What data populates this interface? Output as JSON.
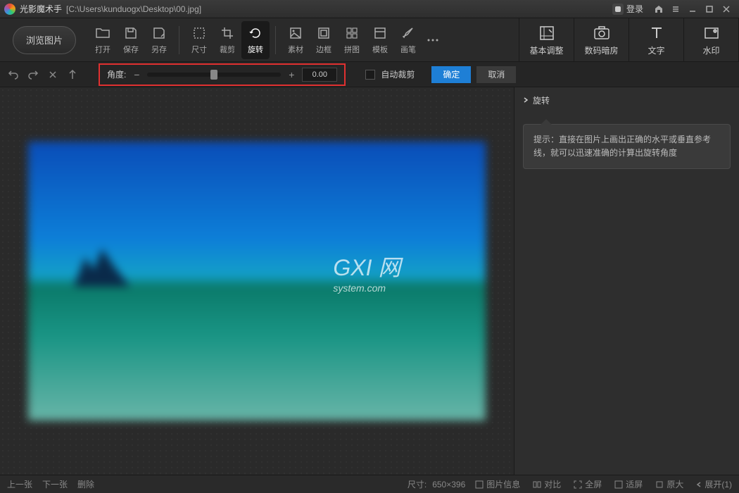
{
  "titlebar": {
    "app_name": "光影魔术手",
    "file_path": "[C:\\Users\\kunduogx\\Desktop\\00.jpg]",
    "login_label": "登录"
  },
  "toolbar": {
    "browse_label": "浏览图片",
    "items": [
      "打开",
      "保存",
      "另存",
      "尺寸",
      "裁剪",
      "旋转",
      "素材",
      "边框",
      "拼图",
      "模板",
      "画笔"
    ],
    "active_index": 5
  },
  "right_tools": [
    "基本调整",
    "数码暗房",
    "文字",
    "水印"
  ],
  "sub_toolbar": {
    "angle_label": "角度:",
    "angle_value": "0.00",
    "auto_crop_label": "自动裁剪",
    "confirm_label": "确定",
    "cancel_label": "取消"
  },
  "side_panel": {
    "title": "旋转",
    "tip_text": "提示：直接在图片上画出正确的水平或垂直参考线，就可以迅速准确的计算出旋转角度"
  },
  "statusbar": {
    "prev_label": "上一张",
    "next_label": "下一张",
    "delete_label": "删除",
    "size_label": "尺寸:",
    "size_value": "650×396",
    "info_label": "图片信息",
    "compare_label": "对比",
    "fullscreen_label": "全屏",
    "fit_label": "适屏",
    "original_label": "原大",
    "expand_label": "展开(1)"
  },
  "watermark": {
    "main": "GXI 网",
    "sub": "system.com"
  },
  "colors": {
    "highlight": "#e03030",
    "primary": "#1e7fd6"
  }
}
